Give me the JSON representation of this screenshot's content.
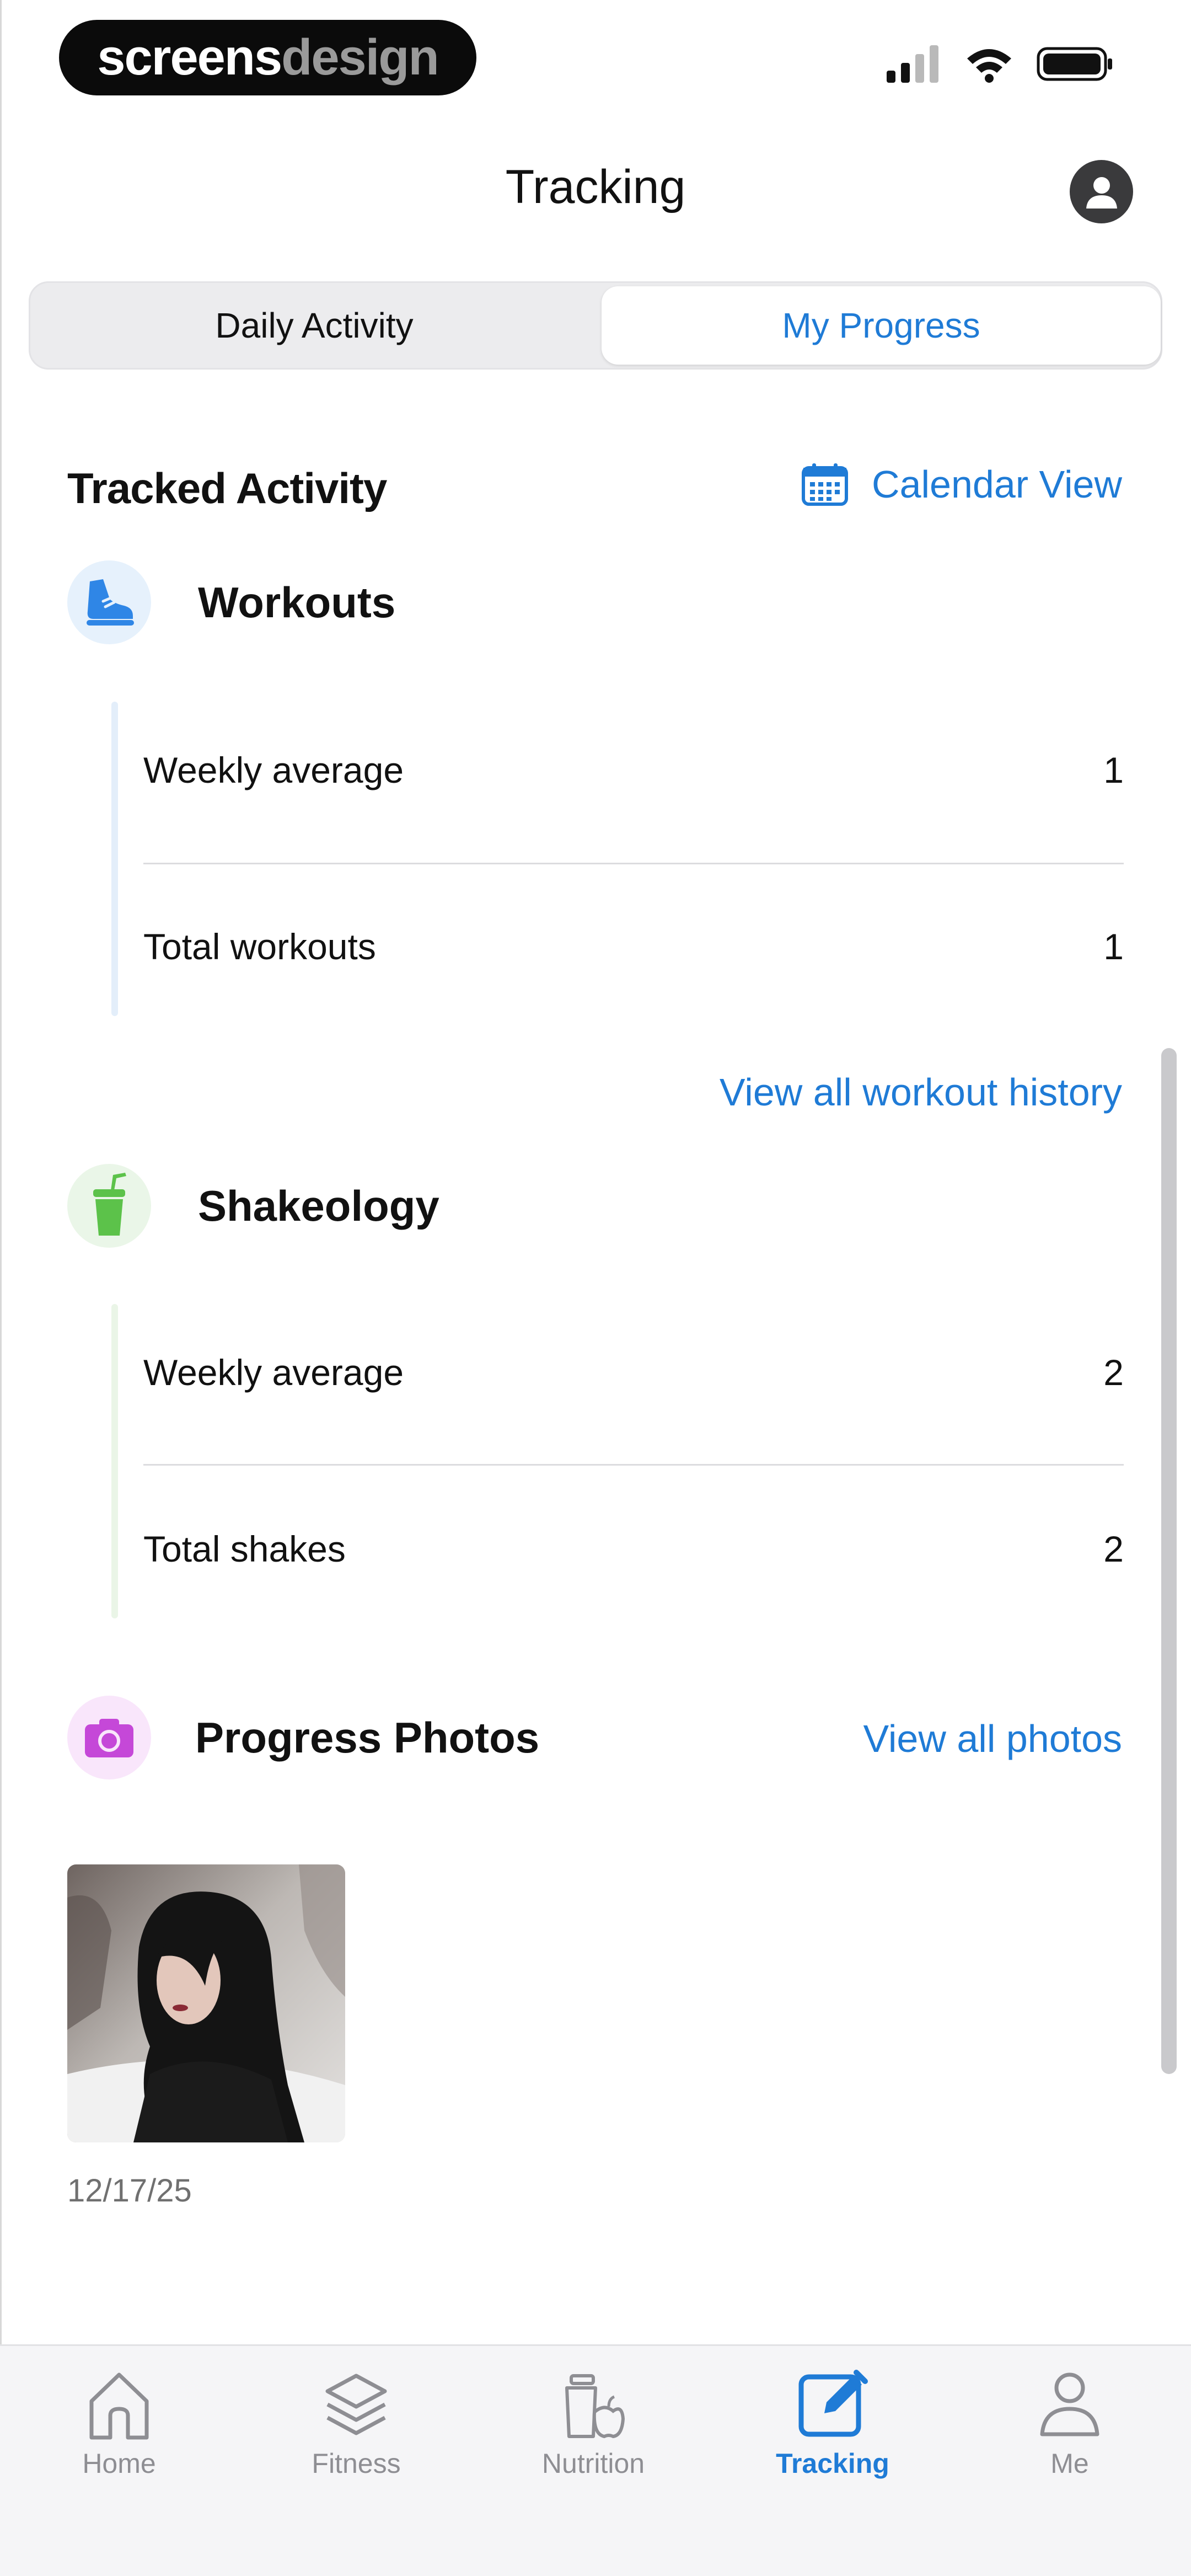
{
  "status_bar": {
    "brand_part1": "screens",
    "brand_part2": "design"
  },
  "header": {
    "title": "Tracking"
  },
  "segmented_control": {
    "options": [
      "Daily Activity",
      "My Progress"
    ],
    "selected": "My Progress"
  },
  "tracked_activity": {
    "heading": "Tracked Activity",
    "calendar_label": "Calendar View"
  },
  "workouts": {
    "title": "Workouts",
    "icon": "shoe-icon",
    "color": "#2f86e6",
    "stats": [
      {
        "label": "Weekly average",
        "value": "1"
      },
      {
        "label": "Total workouts",
        "value": "1"
      }
    ],
    "history_link": "View all workout history"
  },
  "shakeology": {
    "title": "Shakeology",
    "icon": "shake-cup-icon",
    "color": "#5cc24a",
    "stats": [
      {
        "label": "Weekly average",
        "value": "2"
      },
      {
        "label": "Total shakes",
        "value": "2"
      }
    ]
  },
  "progress_photos": {
    "title": "Progress Photos",
    "icon": "camera-icon",
    "color": "#c548d8",
    "view_all_label": "View all photos",
    "photos": [
      {
        "date": "12/17/25"
      }
    ]
  },
  "tab_bar": {
    "items": [
      {
        "label": "Home",
        "icon": "home-icon"
      },
      {
        "label": "Fitness",
        "icon": "layers-icon"
      },
      {
        "label": "Nutrition",
        "icon": "nutrition-icon"
      },
      {
        "label": "Tracking",
        "icon": "edit-square-icon"
      },
      {
        "label": "Me",
        "icon": "person-icon"
      }
    ],
    "active": "Tracking",
    "accent": "#1f7bd6",
    "inactive_color": "#8e8e93"
  }
}
